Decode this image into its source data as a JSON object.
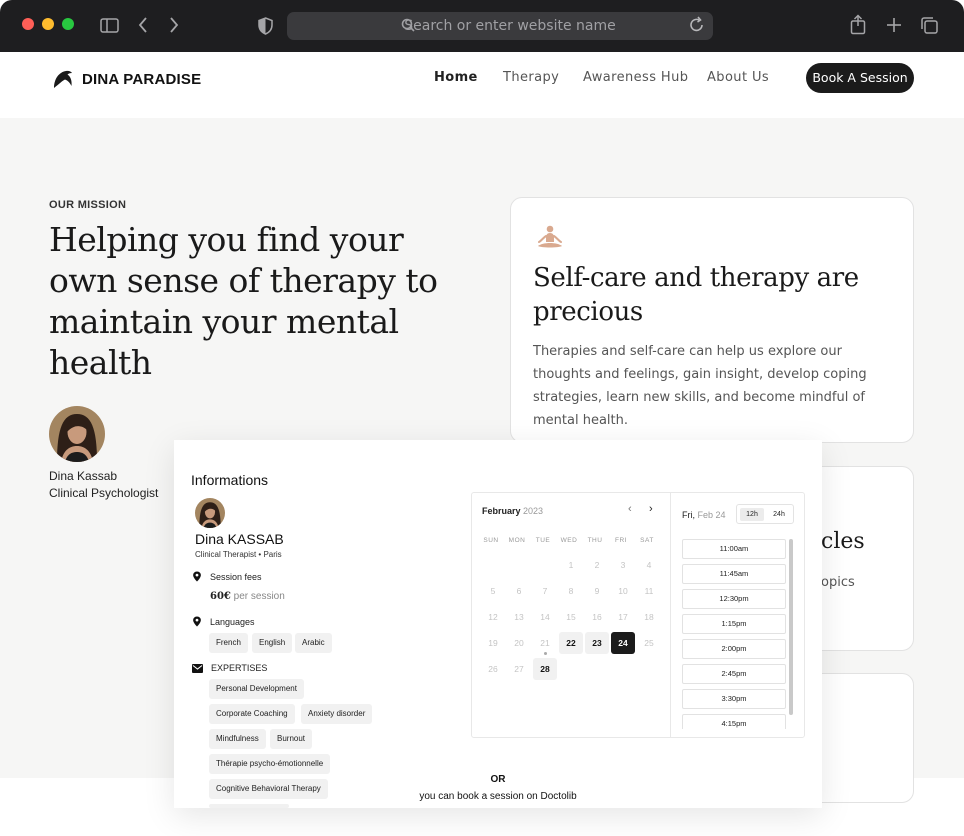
{
  "browser": {
    "url_placeholder": "Search or enter website name"
  },
  "site": {
    "logo_text_bold": "DINA",
    "logo_text_rest": "PARADISE",
    "nav": [
      "Home",
      "Therapy",
      "Awareness Hub",
      "About Us"
    ],
    "cta": "Book A Session"
  },
  "hero": {
    "label": "OUR MISSION",
    "title": "Helping you find your own sense of therapy to maintain your mental health",
    "name": "Dina Kassab",
    "role": "Clinical Psychologist"
  },
  "cards": {
    "selfcare_title": "Self-care and therapy are precious",
    "selfcare_text": "Therapies and self-care can help us explore our thoughts and feelings, gain insight, develop coping strategies, learn new skills, and become mindful of mental health.",
    "articles_title_partial": "cles",
    "articles_text_partial": "opics"
  },
  "booking": {
    "title": "Informations",
    "doctor_name": "Dina KASSAB",
    "doctor_sub": "Clinical Therapist  •  Paris",
    "fees_label": "Session fees",
    "fee_amount": "60€",
    "fee_unit": "per session",
    "languages_label": "Languages",
    "languages": [
      "French",
      "English",
      "Arabic"
    ],
    "expertises_label": "EXPERTISES",
    "expertises": [
      "Personal Development",
      "Corporate Coaching",
      "Anxiety disorder",
      "Mindfulness",
      "Burnout",
      "Thérapie psycho-émotionnelle",
      "Cognitive Behavioral Therapy"
    ],
    "calendar": {
      "month": "February",
      "year": "2023",
      "prev": "‹",
      "next": "›",
      "weekdays": [
        "SUN",
        "MON",
        "TUE",
        "WED",
        "THU",
        "FRI",
        "SAT"
      ],
      "days": [
        "1",
        "2",
        "3",
        "4",
        "5",
        "6",
        "7",
        "8",
        "9",
        "10",
        "11",
        "12",
        "13",
        "14",
        "15",
        "16",
        "17",
        "18",
        "19",
        "20",
        "21",
        "22",
        "23",
        "24",
        "25",
        "26",
        "27",
        "28"
      ],
      "available_days": [
        "22",
        "23",
        "28"
      ],
      "selected_day": "24",
      "today_day": "21"
    },
    "slot_day": "Fri",
    "slot_date": "Feb 24",
    "hour_12": "12h",
    "hour_24": "24h",
    "slots": [
      "11:00am",
      "11:45am",
      "12:30pm",
      "1:15pm",
      "2:00pm",
      "2:45pm",
      "3:30pm",
      "4:15pm"
    ],
    "or_text": "OR",
    "doctolib_text": "you can book a session on Doctolib"
  }
}
